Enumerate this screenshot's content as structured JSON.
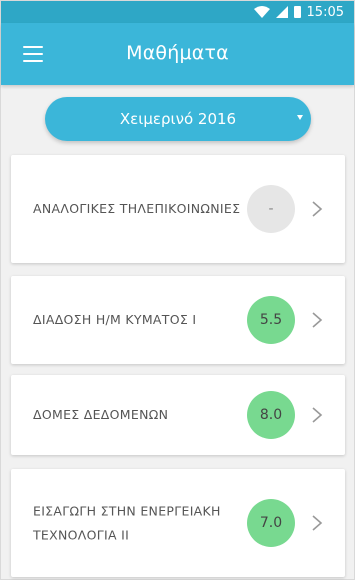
{
  "status_bar": {
    "time": "15:05"
  },
  "app_bar": {
    "title": "Μαθήματα"
  },
  "semester": {
    "selected": "Χειμερινό 2016"
  },
  "courses": [
    {
      "name": "ΑΝΑΛΟΓΙΚΕΣ ΤΗΛΕΠΙΚΟΙΝΩΝΙΕΣ",
      "grade": "-"
    },
    {
      "name": "ΔΙΑΔΟΣΗ Η/Μ ΚΥΜΑΤΟΣ Ι",
      "grade": "5.5"
    },
    {
      "name": "ΔΟΜΕΣ ΔΕΔΟΜΕΝΩΝ",
      "grade": "8.0"
    },
    {
      "name": "ΕΙΣΑΓΩΓΗ ΣΤΗΝ ΕΝΕΡΓΕΙΑΚΗ ΤΕΧΝΟΛΟΓΙΑ ΙΙ",
      "grade": "7.0"
    }
  ],
  "colors": {
    "primary": "#3bb6d9",
    "status_bar": "#2ea7c6",
    "grade_pass": "#78d990",
    "grade_empty": "#e6e6e6"
  }
}
